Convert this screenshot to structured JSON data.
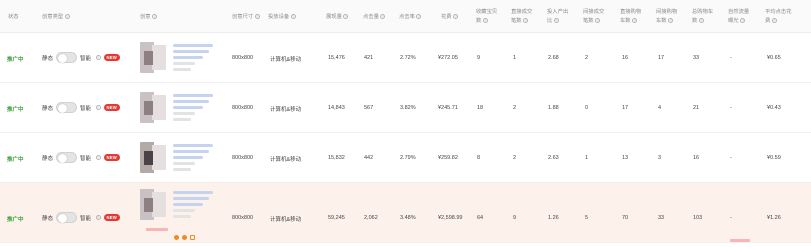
{
  "table": {
    "headers": [
      "状态",
      "创意类型",
      "创意",
      "创意尺寸",
      "投放设备",
      "展现量",
      "点击量",
      "点击率",
      "花费",
      "收藏宝贝数",
      "直接成交笔数",
      "投入产出比",
      "间接成交笔数",
      "直接购物车数",
      "间接购物车数",
      "总购物车数",
      "自然流量曝光",
      "平均点击花费"
    ],
    "type_labels": {
      "static": "静态",
      "smart": "智能",
      "new_badge": "NEW"
    },
    "rows": [
      {
        "status": "推广中",
        "size": "800x800",
        "device": "计算机&移动",
        "impressions": "15,476",
        "clicks": "421",
        "ctr": "2.72%",
        "cost": "¥272.05",
        "fav": "9",
        "direct_orders": "1",
        "roi": "2.68",
        "indirect_orders": "2",
        "direct_cart": "16",
        "indirect_cart": "17",
        "total_cart": "33",
        "natural": "-",
        "avg_cpc": "¥0.65"
      },
      {
        "status": "推广中",
        "size": "800x800",
        "device": "计算机&移动",
        "impressions": "14,843",
        "clicks": "567",
        "ctr": "3.82%",
        "cost": "¥245.71",
        "fav": "18",
        "direct_orders": "2",
        "roi": "1.88",
        "indirect_orders": "0",
        "direct_cart": "17",
        "indirect_cart": "4",
        "total_cart": "21",
        "natural": "-",
        "avg_cpc": "¥0.43"
      },
      {
        "status": "推广中",
        "size": "800x800",
        "device": "计算机&移动",
        "impressions": "15,832",
        "clicks": "442",
        "ctr": "2.79%",
        "cost": "¥259.82",
        "fav": "8",
        "direct_orders": "2",
        "roi": "2.63",
        "indirect_orders": "1",
        "direct_cart": "13",
        "indirect_cart": "3",
        "total_cart": "16",
        "natural": "-",
        "avg_cpc": "¥0.59"
      },
      {
        "status": "推广中",
        "size": "800x800",
        "device": "计算机&移动",
        "impressions": "59,245",
        "clicks": "2,062",
        "ctr": "3.48%",
        "cost": "¥2,598.99",
        "fav": "64",
        "direct_orders": "9",
        "roi": "1.26",
        "indirect_orders": "5",
        "direct_cart": "70",
        "indirect_cart": "33",
        "total_cart": "103",
        "natural": "-",
        "avg_cpc": "¥1.26"
      }
    ]
  },
  "colors": {
    "status_active": "#3da13a",
    "new_badge": "#e53935",
    "highlight_row": "#fdf1ec",
    "control_icon": "#f08a24"
  }
}
